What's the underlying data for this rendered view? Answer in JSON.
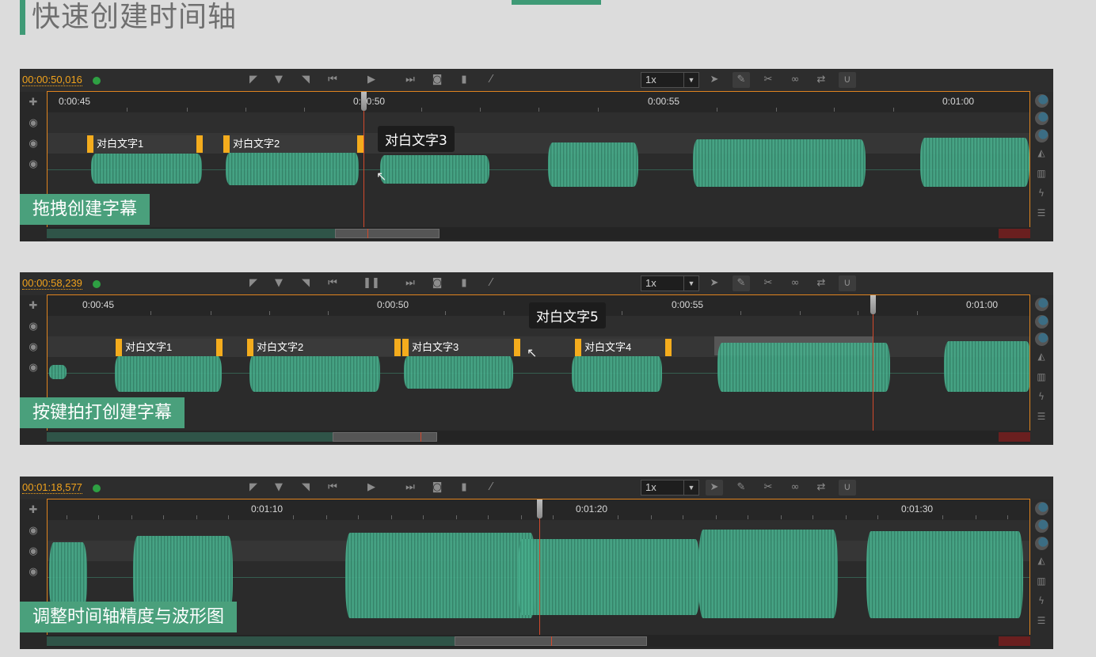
{
  "page": {
    "title": "快速创建时间轴"
  },
  "toolbar": {
    "speed": "1x",
    "icons": [
      "mark-in-icon",
      "mark-down-icon",
      "mark-out-icon",
      "skip-back-icon",
      "play-icon",
      "skip-forward-icon",
      "snapshot-icon",
      "bookmark-icon",
      "magic-wand-icon",
      "pointer-icon",
      "edit-icon",
      "scissors-icon",
      "link-icon",
      "swap-icon",
      "magnet-icon"
    ]
  },
  "panels": [
    {
      "timecode": "00:00:50,016",
      "ruler_labels": [
        "0:00:45",
        "0:00:50",
        "0:00:55",
        "0:01:00"
      ],
      "captions": [
        "对白文字1",
        "对白文字2"
      ],
      "tooltip": "对白文字3",
      "label": "拖拽创建字幕",
      "play_state": "play"
    },
    {
      "timecode": "00:00:58,239",
      "ruler_labels": [
        "0:00:45",
        "0:00:50",
        "0:00:55",
        "0:01:00"
      ],
      "captions": [
        "对白文字1",
        "对白文字2",
        "对白文字3",
        "对白文字4"
      ],
      "tooltip": "对白文字5",
      "label": "按键拍打创建字幕",
      "play_state": "pause"
    },
    {
      "timecode": "00:01:18,577",
      "ruler_labels": [
        "0:01:10",
        "0:01:20",
        "0:01:30"
      ],
      "captions": [],
      "tooltip": "",
      "label": "调整时间轴精度与波形图",
      "play_state": "play"
    }
  ],
  "colors": {
    "accent_green": "#3f9a76",
    "timecode": "#f0a21c",
    "caption_handle": "#f4ac1d",
    "playhead": "#d2492c",
    "track_border": "#e0841f"
  }
}
